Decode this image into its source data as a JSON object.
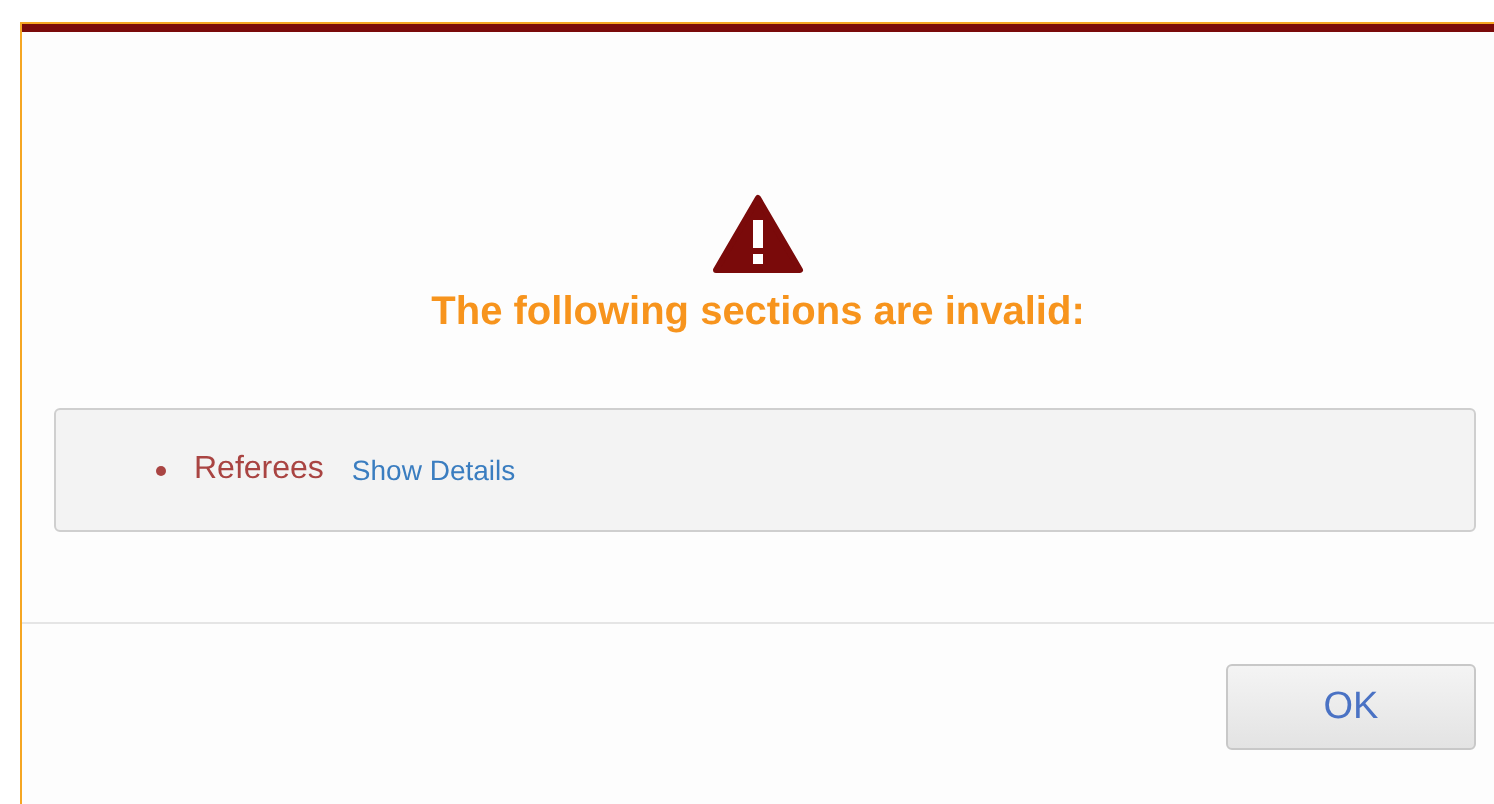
{
  "dialog": {
    "heading": "The following sections are invalid:",
    "sections": [
      {
        "name": "Referees",
        "link": "Show Details"
      }
    ],
    "buttons": [
      "OK"
    ]
  }
}
